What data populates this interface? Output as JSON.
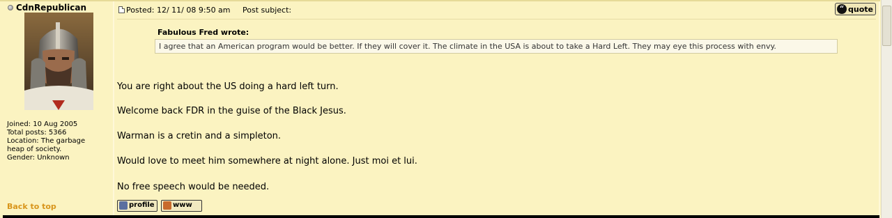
{
  "author": {
    "name": "CdnRepublican",
    "joined": "Joined: 10 Aug 2005",
    "posts": "Total posts: 5366",
    "location_line1": "Location: The garbage",
    "location_line2": "heap of society.",
    "gender": "Gender: Unknown"
  },
  "post": {
    "posted": "Posted: 12/ 11/ 08 9:50 am",
    "subject": "Post subject:",
    "quote_label": "quote",
    "quote_author": "Fabulous Fred wrote:",
    "quote_text": "I agree that an American program would be better. If they will cover it. The climate in the USA is about to take a Hard Left. They may eye this process with envy.",
    "lines": [
      "You are right about the US doing a hard left turn.",
      "Welcome back FDR in the guise of the Black Jesus.",
      "Warman is a cretin and a simpleton.",
      "Would love to meet him somewhere at night alone. Just moi et lui.",
      "No free speech would be needed."
    ]
  },
  "footer": {
    "back_to_top": "Back to top",
    "profile_label": "profile",
    "www_label": "www"
  },
  "colors": {
    "background": "#fbf3c1",
    "link_orange": "#d8951b"
  }
}
